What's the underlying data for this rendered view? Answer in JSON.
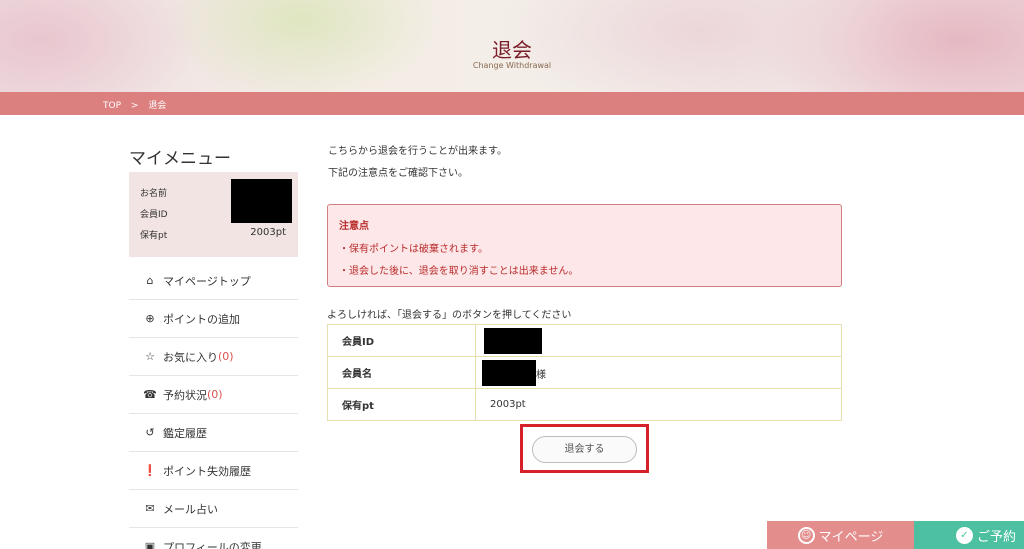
{
  "header": {
    "title": "退会",
    "subtitle": "Change Withdrawal"
  },
  "breadcrumb": {
    "home": "TOP",
    "sep": ">",
    "current": "退会"
  },
  "sidebar": {
    "title": "マイメニュー",
    "profile": {
      "name_label": "お名前",
      "id_label": "会員ID",
      "points_label": "保有pt",
      "points_value": "2003pt"
    },
    "items": [
      {
        "icon": "home-icon",
        "glyph": "⌂",
        "label": "マイページトップ",
        "count": ""
      },
      {
        "icon": "plus-circle-icon",
        "glyph": "⊕",
        "label": "ポイントの追加",
        "count": ""
      },
      {
        "icon": "star-icon",
        "glyph": "☆",
        "label": "お気に入り",
        "count": "(0)"
      },
      {
        "icon": "phone-icon",
        "glyph": "☎",
        "label": "予約状況",
        "count": "(0)"
      },
      {
        "icon": "history-icon",
        "glyph": "↺",
        "label": "鑑定履歴",
        "count": ""
      },
      {
        "icon": "exclamation-icon",
        "glyph": "❗",
        "label": "ポイント失効履歴",
        "count": ""
      },
      {
        "icon": "envelope-icon",
        "glyph": "✉",
        "label": "メール占い",
        "count": ""
      },
      {
        "icon": "id-card-icon",
        "glyph": "▣",
        "label": "プロフィールの変更",
        "count": ""
      }
    ]
  },
  "main": {
    "intro1": "こちらから退会を行うことが出来ます。",
    "intro2": "下記の注意点をご確認下さい。",
    "notice": {
      "title": "注意点",
      "line1": "・保有ポイントは破棄されます。",
      "line2": "・退会した後に、退会を取り消すことは出来ません。"
    },
    "prompt": "よろしければ、「退会する」のボタンを押してください",
    "table": {
      "id_label": "会員ID",
      "name_label": "会員名",
      "name_suffix": "様",
      "points_label": "保有pt",
      "points_value": "2003pt"
    },
    "quit_button": "退会する"
  },
  "footer": {
    "mypage": "マイページ",
    "reserve": "ご予約"
  },
  "colors": {
    "accent": "#dc7f7f",
    "notice_text": "#b92c2c",
    "highlight": "#d6202a",
    "reserve": "#4cc0a0"
  }
}
